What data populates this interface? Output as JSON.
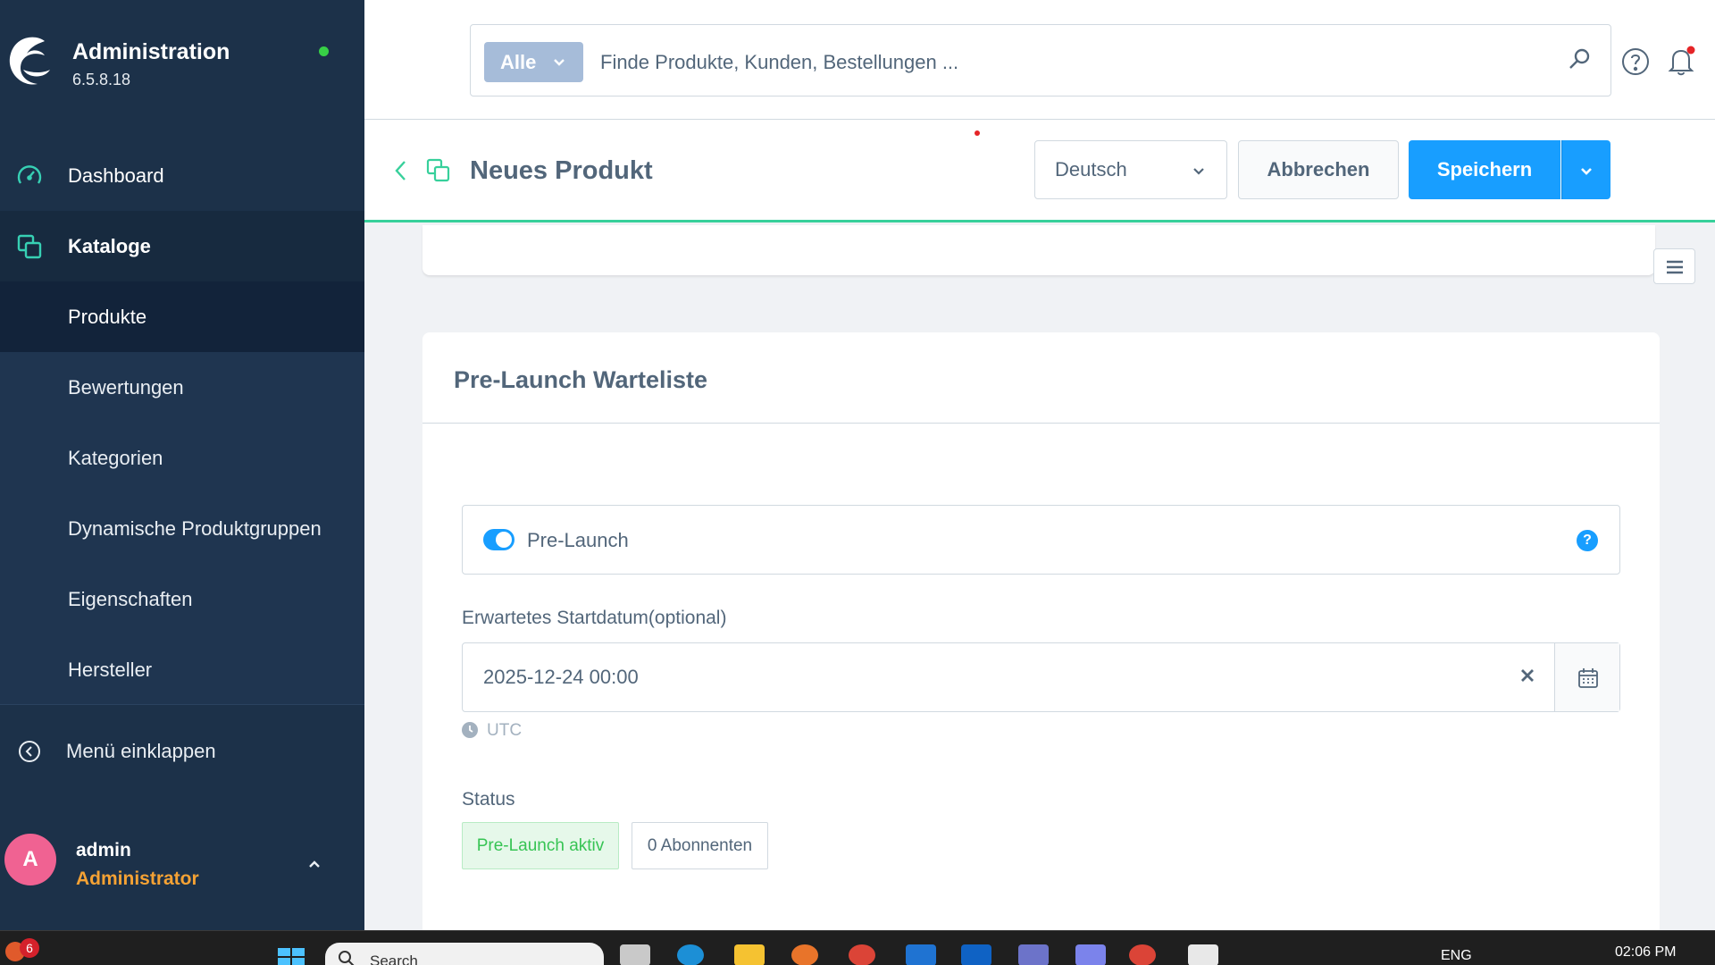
{
  "sidebar": {
    "title": "Administration",
    "version": "6.5.8.18",
    "nav": {
      "dashboard": "Dashboard",
      "kataloge": "Kataloge"
    },
    "sub_items": [
      "Produkte",
      "Bewertungen",
      "Kategorien",
      "Dynamische Produktgruppen",
      "Eigenschaften",
      "Hersteller"
    ],
    "collapse_label": "Menü einklappen",
    "user": {
      "initial": "A",
      "name": "admin",
      "role": "Administrator"
    }
  },
  "topbar": {
    "search_type": "Alle",
    "search_placeholder": "Finde Produkte, Kunden, Bestellungen ..."
  },
  "smartbar": {
    "title": "Neues Produkt",
    "language": "Deutsch",
    "cancel_label": "Abbrechen",
    "save_label": "Speichern"
  },
  "card": {
    "title": "Pre-Launch Warteliste",
    "toggle_label": "Pre-Launch",
    "toggle_on": true,
    "help_glyph": "?",
    "date_label": "Erwartetes Startdatum(optional)",
    "date_value": "2025-12-24 00:00",
    "timezone": "UTC",
    "status_label": "Status",
    "status_badge": "Pre-Launch aktiv",
    "subscribers_badge": "0 Abonnenten"
  },
  "taskbar": {
    "notification_count": "6",
    "search_placeholder": "Search",
    "language": "ENG",
    "time": "02:06 PM"
  },
  "colors": {
    "sidebar_bg": "#1c3149",
    "primary": "#189eff",
    "accent_user_role": "#f5a234",
    "status_active": "#37c454",
    "smartbar_border": "#37d09b"
  }
}
